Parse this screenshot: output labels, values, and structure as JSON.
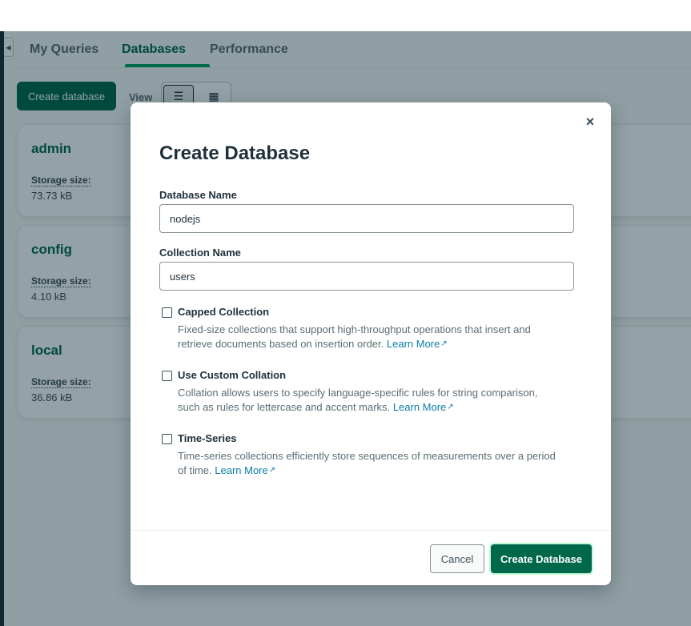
{
  "tabs": [
    {
      "label": "My Queries"
    },
    {
      "label": "Databases"
    },
    {
      "label": "Performance"
    }
  ],
  "toolbar": {
    "create_label": "Create database",
    "view_label": "View"
  },
  "databases": [
    {
      "name": "admin",
      "size_label": "Storage size:",
      "size_value": "73.73 kB"
    },
    {
      "name": "config",
      "size_label": "Storage size:",
      "size_value": "4.10 kB"
    },
    {
      "name": "local",
      "size_label": "Storage size:",
      "size_value": "36.86 kB"
    }
  ],
  "modal": {
    "close_glyph": "×",
    "title": "Create Database",
    "db_name_label": "Database Name",
    "db_name_value": "nodejs",
    "coll_name_label": "Collection Name",
    "coll_name_value": "users",
    "options": [
      {
        "title": "Capped Collection",
        "desc_line1": "Fixed-size collections that support high-throughput operations that insert and",
        "desc_line2": "retrieve documents based on insertion order.",
        "link": "Learn More",
        "checked": false
      },
      {
        "title": "Use Custom Collation",
        "desc_line1": "Collation allows users to specify language-specific rules for string comparison,",
        "desc_line2": "such as rules for lettercase and accent marks.",
        "link": "Learn More",
        "checked": false
      },
      {
        "title": "Time-Series",
        "desc_line1": "Time-series collections efficiently store sequences of measurements over a period",
        "desc_line2": "of time.",
        "link": "Learn More",
        "checked": false
      }
    ],
    "cancel_label": "Cancel",
    "submit_label": "Create Database"
  },
  "colors": {
    "brand_green": "#00684a",
    "accent_green": "#00a35c",
    "link_blue": "#0a7da3"
  }
}
